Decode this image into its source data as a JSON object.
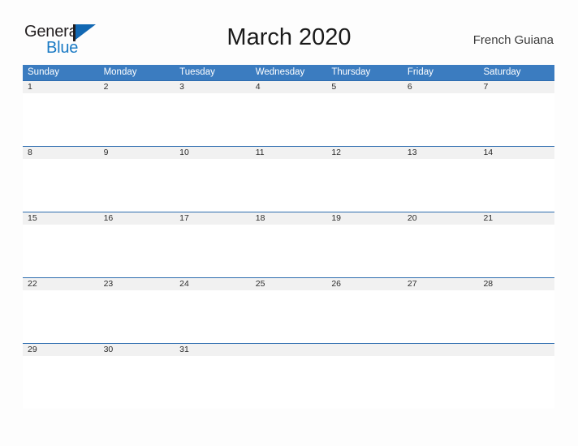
{
  "brand": {
    "name_part1": "General",
    "name_part2": "Blue",
    "flag_icon": "flag-icon",
    "primary_blue": "#1a7ac4",
    "dark": "#231f20"
  },
  "header": {
    "title": "March 2020",
    "locale": "French Guiana"
  },
  "calendar": {
    "header_bg": "#3b7cc0",
    "row_band_bg": "#f1f1f1",
    "row_rule": "#2e6daf",
    "weekdays": [
      "Sunday",
      "Monday",
      "Tuesday",
      "Wednesday",
      "Thursday",
      "Friday",
      "Saturday"
    ],
    "weeks": [
      {
        "days": [
          "1",
          "2",
          "3",
          "4",
          "5",
          "6",
          "7"
        ]
      },
      {
        "days": [
          "8",
          "9",
          "10",
          "11",
          "12",
          "13",
          "14"
        ]
      },
      {
        "days": [
          "15",
          "16",
          "17",
          "18",
          "19",
          "20",
          "21"
        ]
      },
      {
        "days": [
          "22",
          "23",
          "24",
          "25",
          "26",
          "27",
          "28"
        ]
      },
      {
        "days": [
          "29",
          "30",
          "31",
          "",
          "",
          "",
          ""
        ]
      }
    ]
  }
}
